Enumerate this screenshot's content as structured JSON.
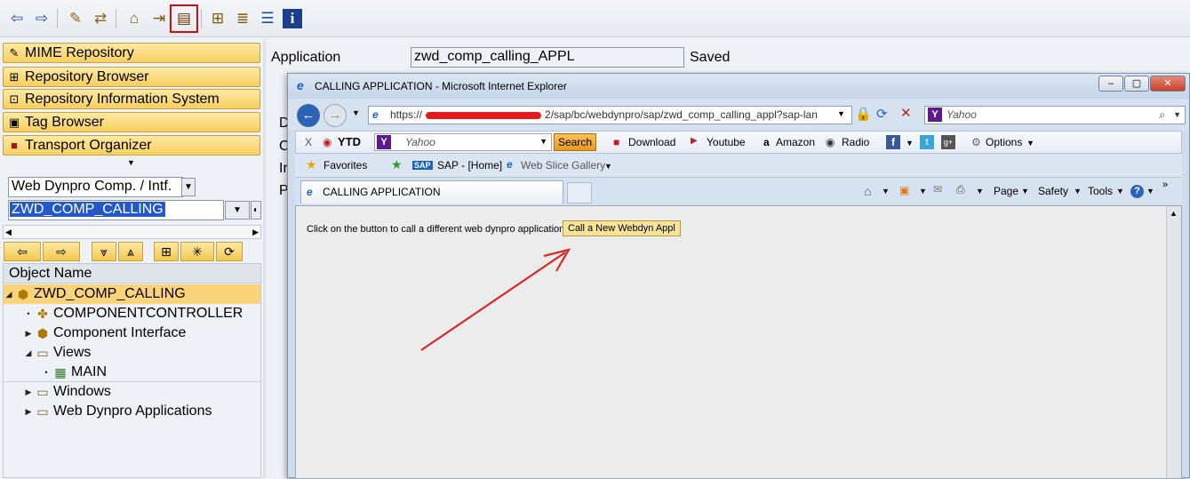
{
  "nav": {
    "items": [
      {
        "label": "MIME Repository",
        "icon": "mime-icon"
      },
      {
        "label": "Repository Browser",
        "icon": "browser-icon"
      },
      {
        "label": "Repository Information System",
        "icon": "info-system-icon"
      },
      {
        "label": "Tag Browser",
        "icon": "tag-icon"
      },
      {
        "label": "Transport Organizer",
        "icon": "transport-icon"
      }
    ],
    "object_type": "Web Dynpro Comp. / Intf.",
    "object_name_value": "ZWD_COMP_CALLING"
  },
  "tree": {
    "header": "Object Name",
    "rows": [
      {
        "label": "ZWD_COMP_CALLING",
        "icon": "component-icon"
      },
      {
        "label": "COMPONENTCONTROLLER",
        "icon": "controller-icon"
      },
      {
        "label": "Component Interface",
        "icon": "interface-icon"
      },
      {
        "label": "Views",
        "icon": "folder-icon"
      },
      {
        "label": "MAIN",
        "icon": "view-icon"
      },
      {
        "label": "Windows",
        "icon": "folder-icon"
      },
      {
        "label": "Web Dynpro Applications",
        "icon": "folder-icon"
      }
    ]
  },
  "main": {
    "application_label": "Application",
    "application_value": "zwd_comp_calling_APPL",
    "status": "Saved",
    "side_letters": [
      "D",
      "C",
      "Ir",
      "Pi"
    ]
  },
  "ie": {
    "title": "CALLING APPLICATION - Microsoft Internet Explorer",
    "address_prefix": "https://",
    "address_suffix": "2/sap/bc/webdynpro/sap/zwd_comp_calling_appl?sap-lan",
    "search_placeholder": "Yahoo",
    "toolbar": {
      "close": "X",
      "ytd": "YTD",
      "yahoo": "Yahoo",
      "search_btn": "Search",
      "download": "Download",
      "youtube": "Youtube",
      "amazon": "Amazon",
      "radio": "Radio",
      "options": "Options"
    },
    "favorites": {
      "favorites": "Favorites",
      "sap_home": "SAP - [Home]",
      "web_slice": "Web Slice Gallery"
    },
    "tab_title": "CALLING APPLICATION",
    "commands": {
      "page": "Page",
      "safety": "Safety",
      "tools": "Tools"
    },
    "content_text": "Click on the button to call a different web dynpro application",
    "call_button": "Call a New Webdyn Appl"
  },
  "colors": {
    "nav_gold": "#f7cf5e",
    "highlight_red": "#d01010",
    "arrow_red": "#d42a2a",
    "selection_blue": "#2458c8"
  }
}
